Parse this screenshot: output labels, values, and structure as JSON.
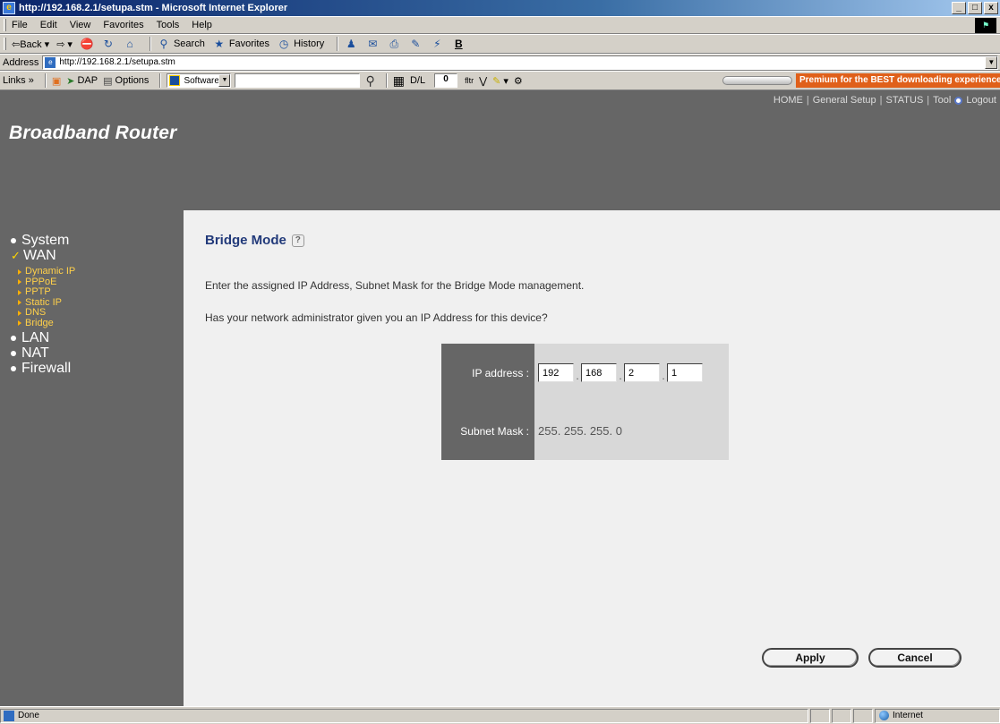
{
  "window": {
    "title": "http://192.168.2.1/setupa.stm - Microsoft Internet Explorer",
    "controls": [
      "_",
      "□",
      "x"
    ]
  },
  "menu": [
    "File",
    "Edit",
    "View",
    "Favorites",
    "Tools",
    "Help"
  ],
  "toolbar": {
    "back": "⇦Back",
    "forward": "⇨",
    "search": "Search",
    "favorites": "Favorites",
    "history": "History"
  },
  "address": {
    "label": "Address",
    "url": "http://192.168.2.1/setupa.stm",
    "go": "Go"
  },
  "links": {
    "label": "Links »",
    "dap": "DAP",
    "options": "Options",
    "software": "Software",
    "dl_label": "D/L",
    "dl_value": "0",
    "premium_ad": "Premium for the BEST downloading experience"
  },
  "header": {
    "brand": "Broadband Router",
    "nav": [
      "HOME",
      "General Setup",
      "STATUS",
      "Tool",
      "Logout"
    ]
  },
  "sidebar": {
    "main_items": [
      {
        "label": "System",
        "active": false
      },
      {
        "label": "WAN",
        "active": true
      },
      {
        "label": "LAN",
        "active": false
      },
      {
        "label": "NAT",
        "active": false
      },
      {
        "label": "Firewall",
        "active": false
      }
    ],
    "wan_sub": [
      "Dynamic IP",
      "PPPoE",
      "PPTP",
      "Static IP",
      "DNS",
      "Bridge"
    ]
  },
  "page": {
    "title": "Bridge Mode",
    "intro": "Enter the assigned IP Address, Subnet Mask for the Bridge Mode management.",
    "question": "Has your network administrator given you an IP Address for this device?",
    "ip_label": "IP address :",
    "ip_octets": [
      "192",
      "168",
      "2",
      "1"
    ],
    "mask_label": "Subnet Mask :",
    "mask_value": "255. 255. 255. 0",
    "apply": "Apply",
    "cancel": "Cancel"
  },
  "status": {
    "text": "Done",
    "zone": "Internet"
  }
}
